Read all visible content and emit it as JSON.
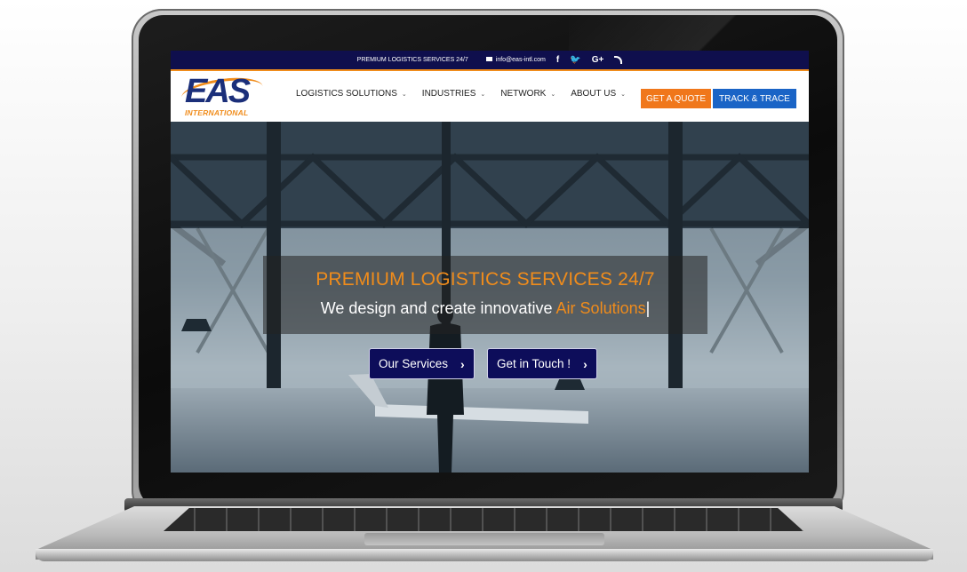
{
  "topbar": {
    "tagline": "PREMIUM LOGISTICS SERVICES 24/7",
    "email": "info@eas-intl.com",
    "social_facebook": "f",
    "social_twitter": "🐦",
    "social_google": "G+",
    "icons": [
      "mail-icon",
      "facebook-icon",
      "twitter-icon",
      "google-plus-icon",
      "rss-icon"
    ]
  },
  "logo": {
    "main": "EAS",
    "sub": "INTERNATIONAL"
  },
  "nav": {
    "items": [
      {
        "label": "LOGISTICS SOLUTIONS"
      },
      {
        "label": "INDUSTRIES"
      },
      {
        "label": "NETWORK"
      },
      {
        "label": "ABOUT US"
      }
    ],
    "chevron": "⌄",
    "quote_label": "GET A QUOTE",
    "track_label": "TRACK & TRACE"
  },
  "hero": {
    "title": "PREMIUM LOGISTICS SERVICES 24/7",
    "subtitle_prefix": "We design and create innovative ",
    "subtitle_accent": "Air Solutions",
    "cursor": "|",
    "btn_services": "Our Services",
    "btn_contact": "Get in Touch !",
    "arrow": "›"
  },
  "colors": {
    "topbar": "#0f0f4d",
    "accent_orange": "#f08c1b",
    "quote_button": "#f0771b",
    "track_button": "#1a64c6",
    "hero_button": "#0d0d5a"
  }
}
